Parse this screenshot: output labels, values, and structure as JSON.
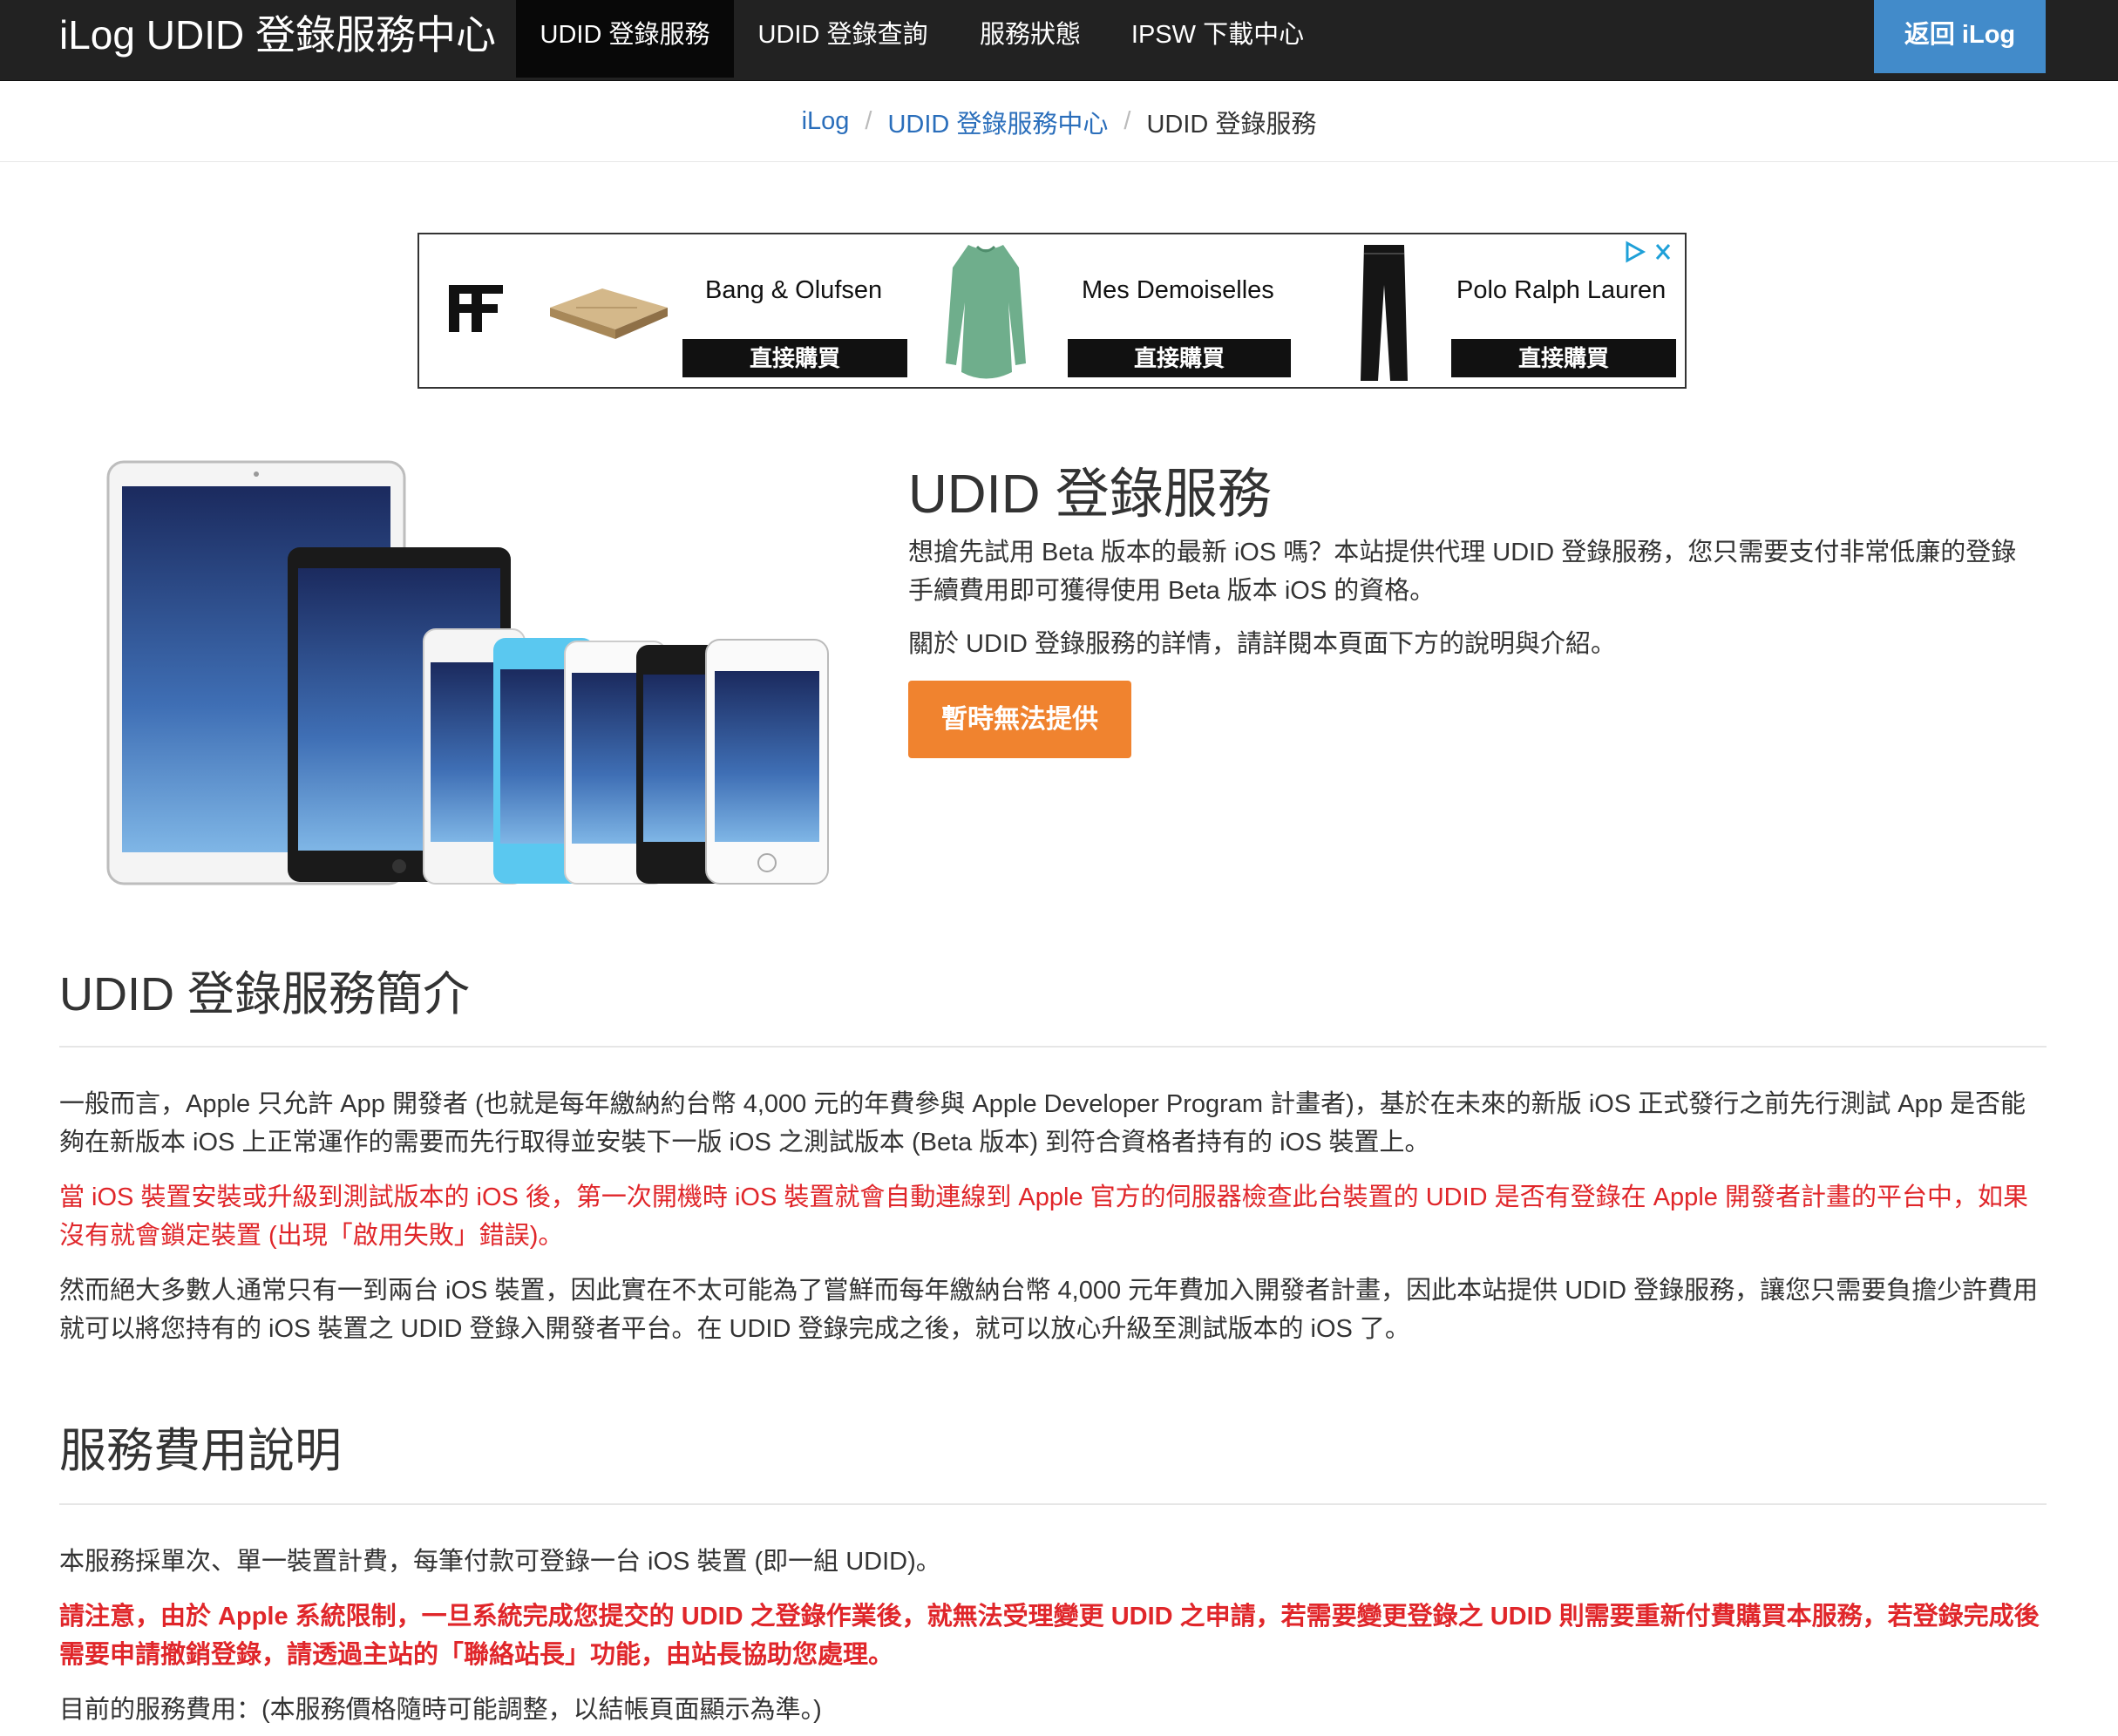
{
  "navbar": {
    "brand": "iLog UDID 登錄服務中心",
    "items": [
      {
        "label": "UDID 登錄服務",
        "active": true
      },
      {
        "label": "UDID 登錄查詢",
        "active": false
      },
      {
        "label": "服務狀態",
        "active": false
      },
      {
        "label": "IPSW 下載中心",
        "active": false
      }
    ],
    "back_label": "返回 iLog",
    "accent": "#428bca"
  },
  "breadcrumb": {
    "items": [
      "iLog",
      "UDID 登錄服務中心"
    ],
    "current": "UDID 登錄服務",
    "separator": "/"
  },
  "ad": {
    "products": [
      {
        "brand": "Bang & Olufsen",
        "cta": "直接購買",
        "image": "wood-speaker-image"
      },
      {
        "brand": "Mes Demoiselles",
        "cta": "直接購買",
        "image": "green-sweater-image"
      },
      {
        "brand": "Polo Ralph Lauren",
        "cta": "直接購買",
        "image": "black-pants-image"
      }
    ],
    "choice_icons": [
      "adchoices-icon",
      "close-icon"
    ]
  },
  "hero": {
    "title": "UDID 登錄服務",
    "paragraph1": "想搶先試用 Beta 版本的最新 iOS 嗎？本站提供代理 UDID 登錄服務，您只需要支付非常低廉的登錄手續費用即可獲得使用 Beta 版本 iOS 的資格。",
    "paragraph2": "關於 UDID 登錄服務的詳情，請詳閱本頁面下方的說明與介紹。",
    "cta": "暫時無法提供",
    "cta_color": "#f0832f"
  },
  "intro": {
    "title": "UDID 登錄服務簡介",
    "p1": "一般而言，Apple 只允許 App 開發者 (也就是每年繳納約台幣 4,000 元的年費參與 Apple Developer Program 計畫者)，基於在未來的新版 iOS 正式發行之前先行測試 App 是否能夠在新版本 iOS 上正常運作的需要而先行取得並安裝下一版 iOS 之測試版本 (Beta 版本) 到符合資格者持有的 iOS 裝置上。",
    "p2": "當 iOS 裝置安裝或升級到測試版本的 iOS 後，第一次開機時 iOS 裝置就會自動連線到 Apple 官方的伺服器檢查此台裝置的 UDID 是否有登錄在 Apple 開發者計畫的平台中，如果沒有就會鎖定裝置 (出現「啟用失敗」錯誤)。",
    "p3": "然而絕大多數人通常只有一到兩台 iOS 裝置，因此實在不太可能為了嘗鮮而每年繳納台幣 4,000 元年費加入開發者計畫，因此本站提供 UDID 登錄服務，讓您只需要負擔少許費用就可以將您持有的 iOS 裝置之 UDID 登錄入開發者平台。在 UDID 登錄完成之後，就可以放心升級至測試版本的 iOS 了。"
  },
  "fees": {
    "title": "服務費用說明",
    "p1": "本服務採單次、單一裝置計費，每筆付款可登錄一台 iOS 裝置 (即一組 UDID)。",
    "p2": "請注意，由於 Apple 系統限制，一旦系統完成您提交的 UDID 之登錄作業後，就無法受理變更 UDID 之申請，若需要變更登錄之 UDID 則需要重新付費購買本服務，若登錄完成後需要申請撤銷登錄，請透過主站的「聯絡站長」功能，由站長協助您處理。",
    "p3": "目前的服務費用：(本服務價格隨時可能調整，以結帳頁面顯示為準。)"
  },
  "colors": {
    "warning_red": "#e0262a",
    "link_blue": "#2a6ebb"
  }
}
